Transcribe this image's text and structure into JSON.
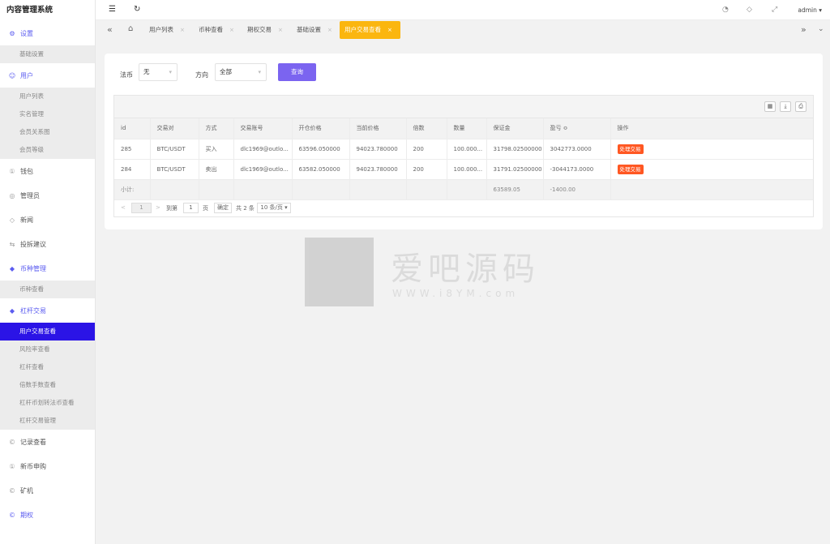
{
  "app": {
    "title": "内容管理系统",
    "user": "admin"
  },
  "sidebar": {
    "groups": [
      {
        "label": "设置",
        "icon": "gear-icon",
        "glyph": "⚙",
        "active": true,
        "items": [
          {
            "label": "基础设置"
          }
        ]
      },
      {
        "label": "用户",
        "icon": "user-icon",
        "glyph": "☺",
        "active": true,
        "items": [
          {
            "label": "用户列表"
          },
          {
            "label": "实名管理"
          },
          {
            "label": "会员关系图"
          },
          {
            "label": "会员等级"
          }
        ]
      },
      {
        "label": "钱包",
        "icon": "wallet-icon",
        "glyph": "①",
        "active": false,
        "items": []
      },
      {
        "label": "管理员",
        "icon": "shield-icon",
        "glyph": "◎",
        "active": false,
        "items": []
      },
      {
        "label": "新闻",
        "icon": "tag-icon",
        "glyph": "◇",
        "active": false,
        "items": []
      },
      {
        "label": "投拆建议",
        "icon": "link-icon",
        "glyph": "⇆",
        "active": false,
        "items": []
      },
      {
        "label": "币种管理",
        "icon": "diamond-icon",
        "glyph": "◆",
        "active": true,
        "items": [
          {
            "label": "币种查看"
          }
        ]
      },
      {
        "label": "杠杆交易",
        "icon": "diamond-icon",
        "glyph": "◆",
        "active": true,
        "items": [
          {
            "label": "用户交易查看",
            "selected": true
          },
          {
            "label": "风险率查看"
          },
          {
            "label": "杠杆查看"
          },
          {
            "label": "倍数手数查看"
          },
          {
            "label": "杠杆币划转法币查看"
          },
          {
            "label": "杠杆交易管理"
          }
        ]
      },
      {
        "label": "记录查看",
        "icon": "clock-icon",
        "glyph": "©",
        "active": false,
        "items": []
      },
      {
        "label": "新币申购",
        "icon": "coin-icon",
        "glyph": "①",
        "active": false,
        "items": []
      },
      {
        "label": "矿机",
        "icon": "clock-icon",
        "glyph": "©",
        "active": false,
        "items": []
      },
      {
        "label": "期权",
        "icon": "clock-icon",
        "glyph": "©",
        "active": true,
        "items": []
      }
    ]
  },
  "tabs": [
    {
      "label": "用户列表",
      "active": false
    },
    {
      "label": "币种查看",
      "active": false
    },
    {
      "label": "期权交易",
      "active": false
    },
    {
      "label": "基础设置",
      "active": false
    },
    {
      "label": "用户交易查看",
      "active": true
    }
  ],
  "tab_close": "×",
  "filters": {
    "fiat_label": "法币",
    "fiat_value": "无",
    "direction_label": "方向",
    "direction_value": "全部",
    "query_button": "查询"
  },
  "table": {
    "columns": [
      "id",
      "交易对",
      "方式",
      "交易账号",
      "开仓价格",
      "当前价格",
      "倍数",
      "数量",
      "保证金",
      "盈亏 ≎",
      "操作"
    ],
    "rows": [
      [
        "285",
        "BTC/USDT",
        "买入",
        "dlc1969@outlo...",
        "63596.050000",
        "94023.780000",
        "200",
        "100.000...",
        "31798.02500000",
        "3042773.0000",
        "处理交易"
      ],
      [
        "284",
        "BTC/USDT",
        "卖出",
        "dlc1969@outlo...",
        "63582.050000",
        "94023.780000",
        "200",
        "100.000...",
        "31791.02500000",
        "-3044173.0000",
        "处理交易"
      ]
    ],
    "subtotal": [
      "小计:",
      "",
      "",
      "",
      "",
      "",
      "",
      "",
      "63589.05",
      "-1400.00",
      ""
    ]
  },
  "pager": {
    "prev": "<",
    "page": "1",
    "next": ">",
    "goto": "到第",
    "goto_value": "1",
    "page_unit": "页",
    "confirm": "确定",
    "total": "共 2 条",
    "per_page": "10 条/页 ▾"
  },
  "watermark": {
    "text": "爱吧源码",
    "url": "WWW.i8YM.com"
  }
}
